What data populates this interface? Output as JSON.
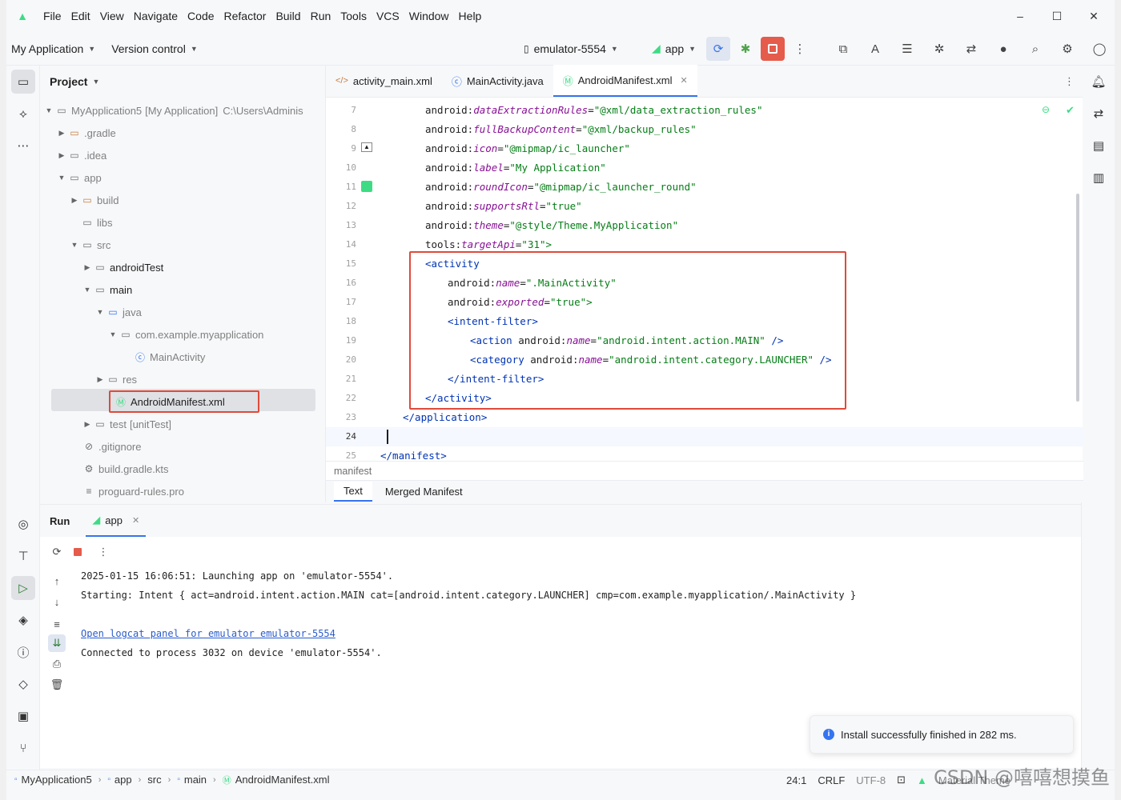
{
  "menu": [
    "File",
    "Edit",
    "View",
    "Navigate",
    "Code",
    "Refactor",
    "Build",
    "Run",
    "Tools",
    "VCS",
    "Window",
    "Help"
  ],
  "toolbar": {
    "project_name": "My Application",
    "vcs": "Version control",
    "device": "emulator-5554",
    "run_config": "app"
  },
  "project_panel": {
    "title": "Project",
    "root_name": "MyApplication5",
    "root_module": "[My Application]",
    "root_path": "C:\\Users\\Adminis",
    "items": {
      "gradle": ".gradle",
      "idea": ".idea",
      "app": "app",
      "build": "build",
      "libs": "libs",
      "src": "src",
      "androidTest": "androidTest",
      "main": "main",
      "java": "java",
      "package": "com.example.myapplication",
      "mainactivity": "MainActivity",
      "res": "res",
      "manifest": "AndroidManifest.xml",
      "test": "test",
      "test_suffix": "[unitTest]",
      "gitignore": ".gitignore",
      "buildgradle": "build.gradle.kts",
      "proguard": "proguard-rules.pro"
    }
  },
  "editor": {
    "tabs": [
      "activity_main.xml",
      "MainActivity.java",
      "AndroidManifest.xml"
    ],
    "line_numbers": [
      "7",
      "8",
      "9",
      "10",
      "11",
      "12",
      "13",
      "14",
      "15",
      "16",
      "17",
      "18",
      "19",
      "20",
      "21",
      "22",
      "23",
      "24",
      "25"
    ],
    "code": {
      "l7_attr": "android:",
      "l7_name": "dataExtractionRules",
      "l7_val": "\"@xml/data_extraction_rules\"",
      "l8_attr": "android:",
      "l8_name": "fullBackupContent",
      "l8_val": "\"@xml/backup_rules\"",
      "l9_attr": "android:",
      "l9_name": "icon",
      "l9_val": "\"@mipmap/ic_launcher\"",
      "l10_attr": "android:",
      "l10_name": "label",
      "l10_val": "\"My Application\"",
      "l11_attr": "android:",
      "l11_name": "roundIcon",
      "l11_val": "\"@mipmap/ic_launcher_round\"",
      "l12_attr": "android:",
      "l12_name": "supportsRtl",
      "l12_val": "\"true\"",
      "l13_attr": "android:",
      "l13_name": "theme",
      "l13_val": "\"@style/Theme.MyApplication\"",
      "l14_attr": "tools:",
      "l14_name": "targetApi",
      "l14_val": "\"31\">",
      "l15_tag": "<activity",
      "l16_attr": "android:",
      "l16_name": "name",
      "l16_val": "\".MainActivity\"",
      "l17_attr": "android:",
      "l17_name": "exported",
      "l17_val": "\"true\">",
      "l18_tag": "<intent-filter>",
      "l19_tag": "<action ",
      "l19_attr": "android:",
      "l19_name": "name",
      "l19_val": "\"android.intent.action.MAIN\"",
      "l19_end": " />",
      "l20_tag": "<category ",
      "l20_attr": "android:",
      "l20_name": "name",
      "l20_val": "\"android.intent.category.LAUNCHER\"",
      "l20_end": " />",
      "l21_tag": "</intent-filter>",
      "l22_tag": "</activity>",
      "l23_tag": "</application>",
      "l25_tag": "</manifest>"
    },
    "breadcrumb": "manifest",
    "bottom_tabs": [
      "Text",
      "Merged Manifest"
    ]
  },
  "run_panel": {
    "title": "Run",
    "tab": "app",
    "lines": [
      "2025-01-15 16:06:51: Launching app on 'emulator-5554'.",
      "Starting: Intent { act=android.intent.action.MAIN cat=[android.intent.category.LAUNCHER] cmp=com.example.myapplication/.MainActivity }",
      "Open logcat panel for emulator emulator-5554",
      "Connected to process 3032 on device 'emulator-5554'."
    ]
  },
  "notification": "Install successfully finished in 282 ms.",
  "statusbar": {
    "crumbs": [
      "MyApplication5",
      "app",
      "src",
      "main",
      "AndroidManifest.xml"
    ],
    "position": "24:1",
    "line_sep": "CRLF",
    "encoding": "UTF-8",
    "theme": "Material Theme"
  },
  "watermark": "CSDN @嘻嘻想摸鱼",
  "colors": {
    "accent": "#3574f0",
    "highlight_box": "#e04a3a",
    "android_green": "#3ddc84"
  }
}
